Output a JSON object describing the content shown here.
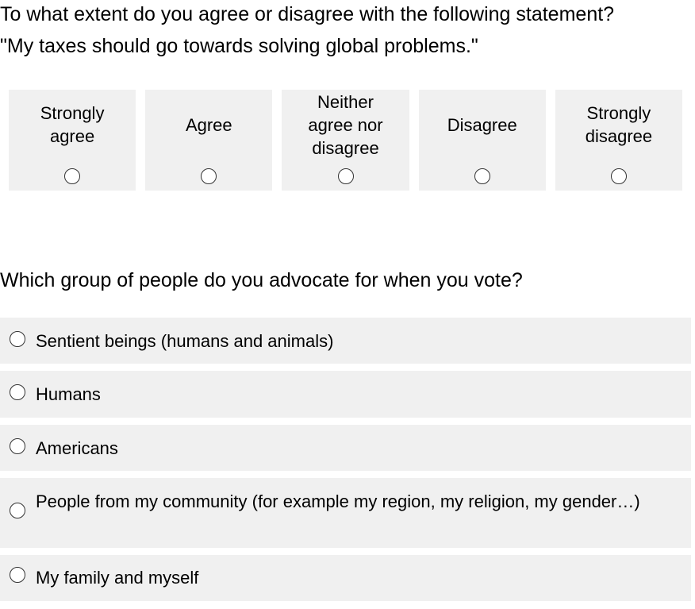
{
  "question1": {
    "text": "To what extent do you agree or disagree with the following statement?\n\"My taxes should go towards solving global problems.\"",
    "options": [
      "Strongly agree",
      "Agree",
      "Neither agree nor disagree",
      "Disagree",
      "Strongly disagree"
    ]
  },
  "question2": {
    "text": "Which group of people do you advocate for when you vote?",
    "options": [
      "Sentient beings (humans and animals)",
      "Humans",
      "Americans",
      "People from my community (for example my region, my religion, my gender…)",
      "My family and myself"
    ]
  }
}
